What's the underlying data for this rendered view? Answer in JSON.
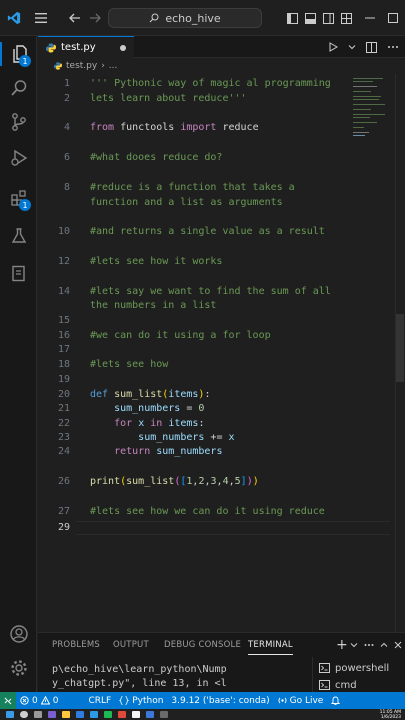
{
  "titlebar": {
    "search_text": "echo_hive"
  },
  "activitybar": {
    "explorer_badge": "1",
    "extensions_badge": "1"
  },
  "tab": {
    "filename": "test.py"
  },
  "breadcrumb": {
    "file": "test.py",
    "more": "..."
  },
  "editor": {
    "line_numbers": [
      "1",
      "2",
      "",
      "4",
      "",
      "6",
      "",
      "8",
      "",
      "10",
      "",
      "12",
      "",
      "14",
      "",
      "15",
      "",
      "16",
      "",
      "17",
      "",
      "18",
      "",
      "19",
      "",
      "20",
      "21",
      "22",
      "23",
      "24",
      "",
      "26",
      "",
      "27",
      "28",
      "29"
    ],
    "active_line": "29"
  },
  "panel": {
    "tabs": {
      "problems": "PROBLEMS",
      "output": "OUTPUT",
      "debug_console": "DEBUG CONSOLE",
      "terminal": "TERMINAL"
    },
    "terminal_lines": [
      "p\\echo_hive\\learn_python\\Nump",
      "y_chatgpt.py\", line 13, in <l"
    ],
    "terminals": [
      "powershell",
      "cmd"
    ]
  },
  "statusbar": {
    "errors": "0",
    "warnings": "0",
    "eol": "CRLF",
    "language": "Python",
    "interpreter": "3.9.12 ('base': conda)",
    "golive": "Go Live"
  },
  "taskbar": {
    "time": "11:05 AM",
    "date": "1/6/2023"
  },
  "colors": {
    "accent": "#0078d4",
    "comment": "#6a9955",
    "keyword": "#569cd6",
    "function": "#dcdcaa",
    "variable": "#9cdcfe",
    "number": "#b5cea8"
  }
}
